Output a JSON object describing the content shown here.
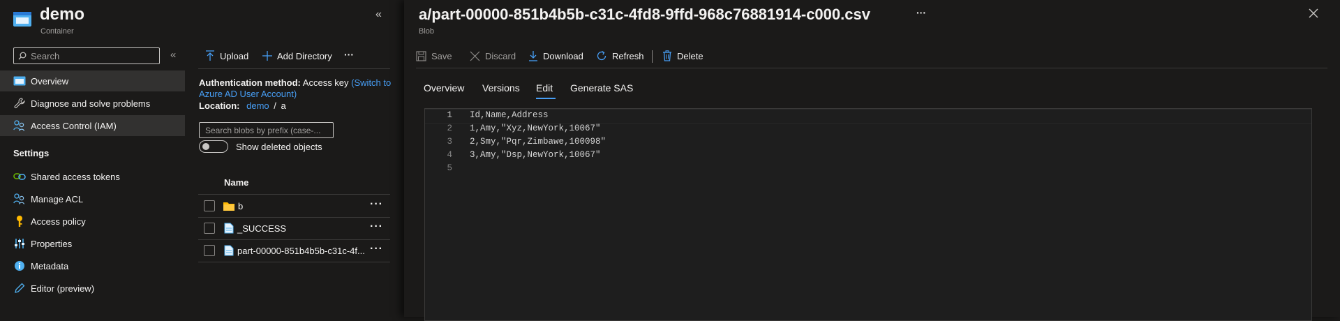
{
  "container": {
    "title": "demo",
    "subtitle": "Container"
  },
  "sidebar": {
    "search_placeholder": "Search",
    "items": [
      {
        "label": "Overview",
        "icon": "overview-icon"
      },
      {
        "label": "Diagnose and solve problems",
        "icon": "wrench-icon"
      },
      {
        "label": "Access Control (IAM)",
        "icon": "people-icon"
      }
    ],
    "settings_heading": "Settings",
    "settings_items": [
      {
        "label": "Shared access tokens",
        "icon": "link-icon"
      },
      {
        "label": "Manage ACL",
        "icon": "people-icon"
      },
      {
        "label": "Access policy",
        "icon": "key-icon"
      },
      {
        "label": "Properties",
        "icon": "sliders-icon"
      },
      {
        "label": "Metadata",
        "icon": "info-icon"
      },
      {
        "label": "Editor (preview)",
        "icon": "pencil-icon"
      }
    ]
  },
  "browser": {
    "toolbar": {
      "upload": "Upload",
      "add_directory": "Add Directory",
      "more": "···"
    },
    "auth_label": "Authentication method:",
    "auth_value": "Access key",
    "auth_switch_link_1": "(Switch to",
    "auth_switch_link_2": "Azure AD User Account)",
    "location_label": "Location:",
    "location_link": "demo",
    "location_sep": "/",
    "location_path": "a",
    "filter_placeholder": "Search blobs by prefix (case-...",
    "show_deleted": "Show deleted objects",
    "column_name": "Name",
    "rows": [
      {
        "name": "b",
        "type": "folder"
      },
      {
        "name": "_SUCCESS",
        "type": "file"
      },
      {
        "name": "part-00000-851b4b5b-c31c-4f...",
        "type": "file"
      }
    ]
  },
  "blob": {
    "title": "a/part-00000-851b4b5b-c31c-4fd8-9ffd-968c76881914-c000.csv",
    "subtitle": "Blob",
    "more": "···",
    "toolbar": {
      "save": "Save",
      "discard": "Discard",
      "download": "Download",
      "refresh": "Refresh",
      "delete": "Delete"
    },
    "tabs": [
      "Overview",
      "Versions",
      "Edit",
      "Generate SAS"
    ],
    "active_tab": "Edit",
    "editor_lines": [
      {
        "n": "1",
        "text": "Id,Name,Address"
      },
      {
        "n": "2",
        "text": "1,Amy,\"Xyz,NewYork,10067\""
      },
      {
        "n": "3",
        "text": "2,Smy,\"Pqr,Zimbawe,100098\""
      },
      {
        "n": "4",
        "text": "3,Amy,\"Dsp,NewYork,10067\""
      },
      {
        "n": "5",
        "text": ""
      }
    ]
  },
  "colors": {
    "accent": "#479ef5",
    "background": "#1b1a19",
    "selected": "#323130",
    "folder": "#ffb900"
  }
}
